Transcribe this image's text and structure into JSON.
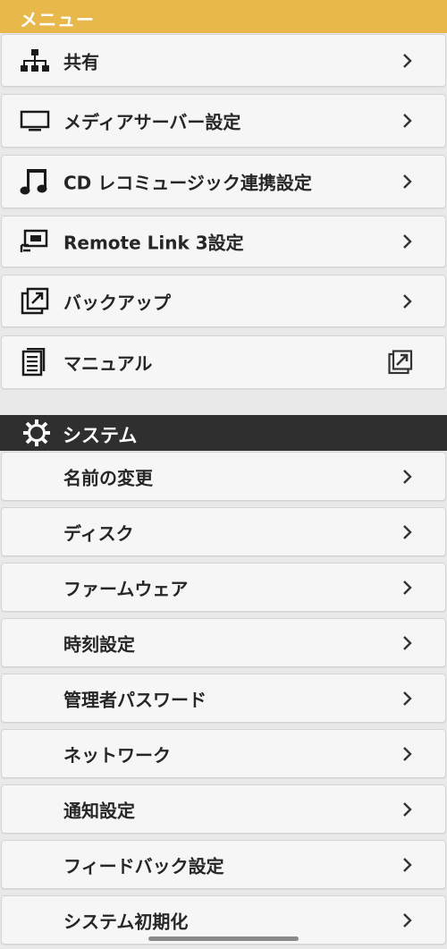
{
  "menu": {
    "title": "メニュー",
    "items": [
      {
        "label": "共有",
        "icon": "network-tree-icon",
        "action": "chevron"
      },
      {
        "label": "メディアサーバー設定",
        "icon": "monitor-icon",
        "action": "chevron"
      },
      {
        "label": "CD レコミュージック連携設定",
        "icon": "music-note-icon",
        "action": "chevron"
      },
      {
        "label": "Remote Link 3設定",
        "icon": "remote-link-icon",
        "action": "chevron"
      },
      {
        "label": "バックアップ",
        "icon": "backup-icon",
        "action": "chevron"
      },
      {
        "label": "マニュアル",
        "icon": "document-icon",
        "action": "external-link"
      }
    ]
  },
  "system": {
    "title": "システム",
    "icon": "gear-icon",
    "items": [
      {
        "label": "名前の変更"
      },
      {
        "label": "ディスク"
      },
      {
        "label": "ファームウェア"
      },
      {
        "label": "時刻設定"
      },
      {
        "label": "管理者パスワード"
      },
      {
        "label": "ネットワーク"
      },
      {
        "label": "通知設定"
      },
      {
        "label": "フィードバック設定"
      },
      {
        "label": "システム初期化"
      }
    ]
  },
  "colors": {
    "menu_header_bg": "#e8b84b",
    "system_header_bg": "#2f2f2f",
    "item_bg": "#f6f6f6",
    "page_bg": "#e9e9e9"
  }
}
